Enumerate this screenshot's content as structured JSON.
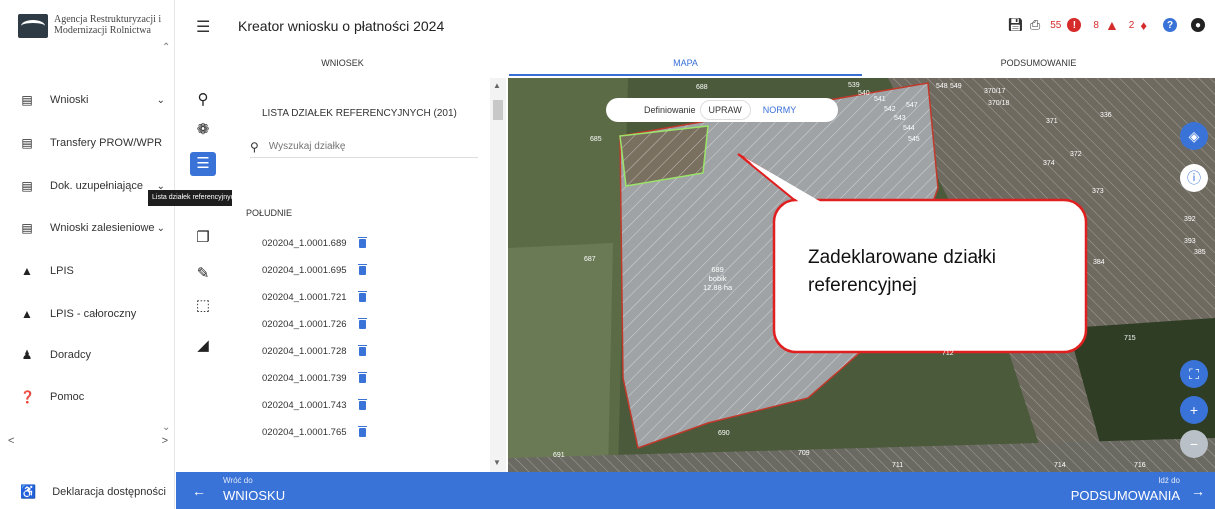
{
  "sidebar": {
    "logo_text": "Agencja Restrukturyzacji i Modernizacji Rolnictwa",
    "items": [
      {
        "label": "Wnioski",
        "icon": "document-icon",
        "expandable": true
      },
      {
        "label": "Transfery PROW/WPR",
        "icon": "document-icon",
        "expandable": false
      },
      {
        "label": "Dok. uzupełniające",
        "icon": "document-icon",
        "expandable": true
      },
      {
        "label": "Wnioski zalesieniowe",
        "icon": "document-icon",
        "expandable": true
      },
      {
        "label": "LPIS",
        "icon": "mountain-icon",
        "expandable": false
      },
      {
        "label": "LPIS - całoroczny",
        "icon": "mountain-icon",
        "expandable": false
      },
      {
        "label": "Doradcy",
        "icon": "person-icon",
        "expandable": false
      },
      {
        "label": "Pomoc",
        "icon": "help-icon",
        "expandable": false
      }
    ],
    "accessibility": "Deklaracja dostępności"
  },
  "header": {
    "title": "Kreator wniosku o płatności 2024",
    "errors_count": "55",
    "warnings_count": "8",
    "notifications_count": "2"
  },
  "tabs": [
    {
      "label": "WNIOSEK",
      "active": false
    },
    {
      "label": "MAPA",
      "active": true
    },
    {
      "label": "PODSUMOWANIE",
      "active": false
    }
  ],
  "tooltip": "Lista działek referencyjnych",
  "list": {
    "title": "LISTA DZIAŁEK REFERENCYJNYCH (201)",
    "search_placeholder": "Wyszukaj działkę",
    "region": "POŁUDNIE",
    "parcels": [
      "020204_1.0001.689",
      "020204_1.0001.695",
      "020204_1.0001.721",
      "020204_1.0001.726",
      "020204_1.0001.728",
      "020204_1.0001.739",
      "020204_1.0001.743",
      "020204_1.0001.765"
    ]
  },
  "map": {
    "mode_label": "Definiowanie",
    "mode_on": "UPRAW",
    "mode_off": "NORMY",
    "callout": "Zadeklarowane działki referencyjnej",
    "parcel_id": "689",
    "parcel_crop": "bobik",
    "parcel_area": "12.88 ha",
    "labels": [
      "685",
      "688",
      "687",
      "690",
      "691",
      "709",
      "711",
      "712",
      "714",
      "715",
      "716",
      "374",
      "384",
      "385",
      "392",
      "393",
      "336",
      "370/17",
      "370/18",
      "371",
      "372",
      "373",
      "547",
      "548",
      "549",
      "545",
      "544",
      "543",
      "542",
      "541",
      "540",
      "539"
    ]
  },
  "footer": {
    "back_small": "Wróć do",
    "back_big": "WNIOSKU",
    "next_small": "Idź do",
    "next_big": "PODSUMOWANIA"
  },
  "colors": {
    "accent": "#3a73d8",
    "error": "#d62b2b",
    "callout_border": "#e02020"
  }
}
